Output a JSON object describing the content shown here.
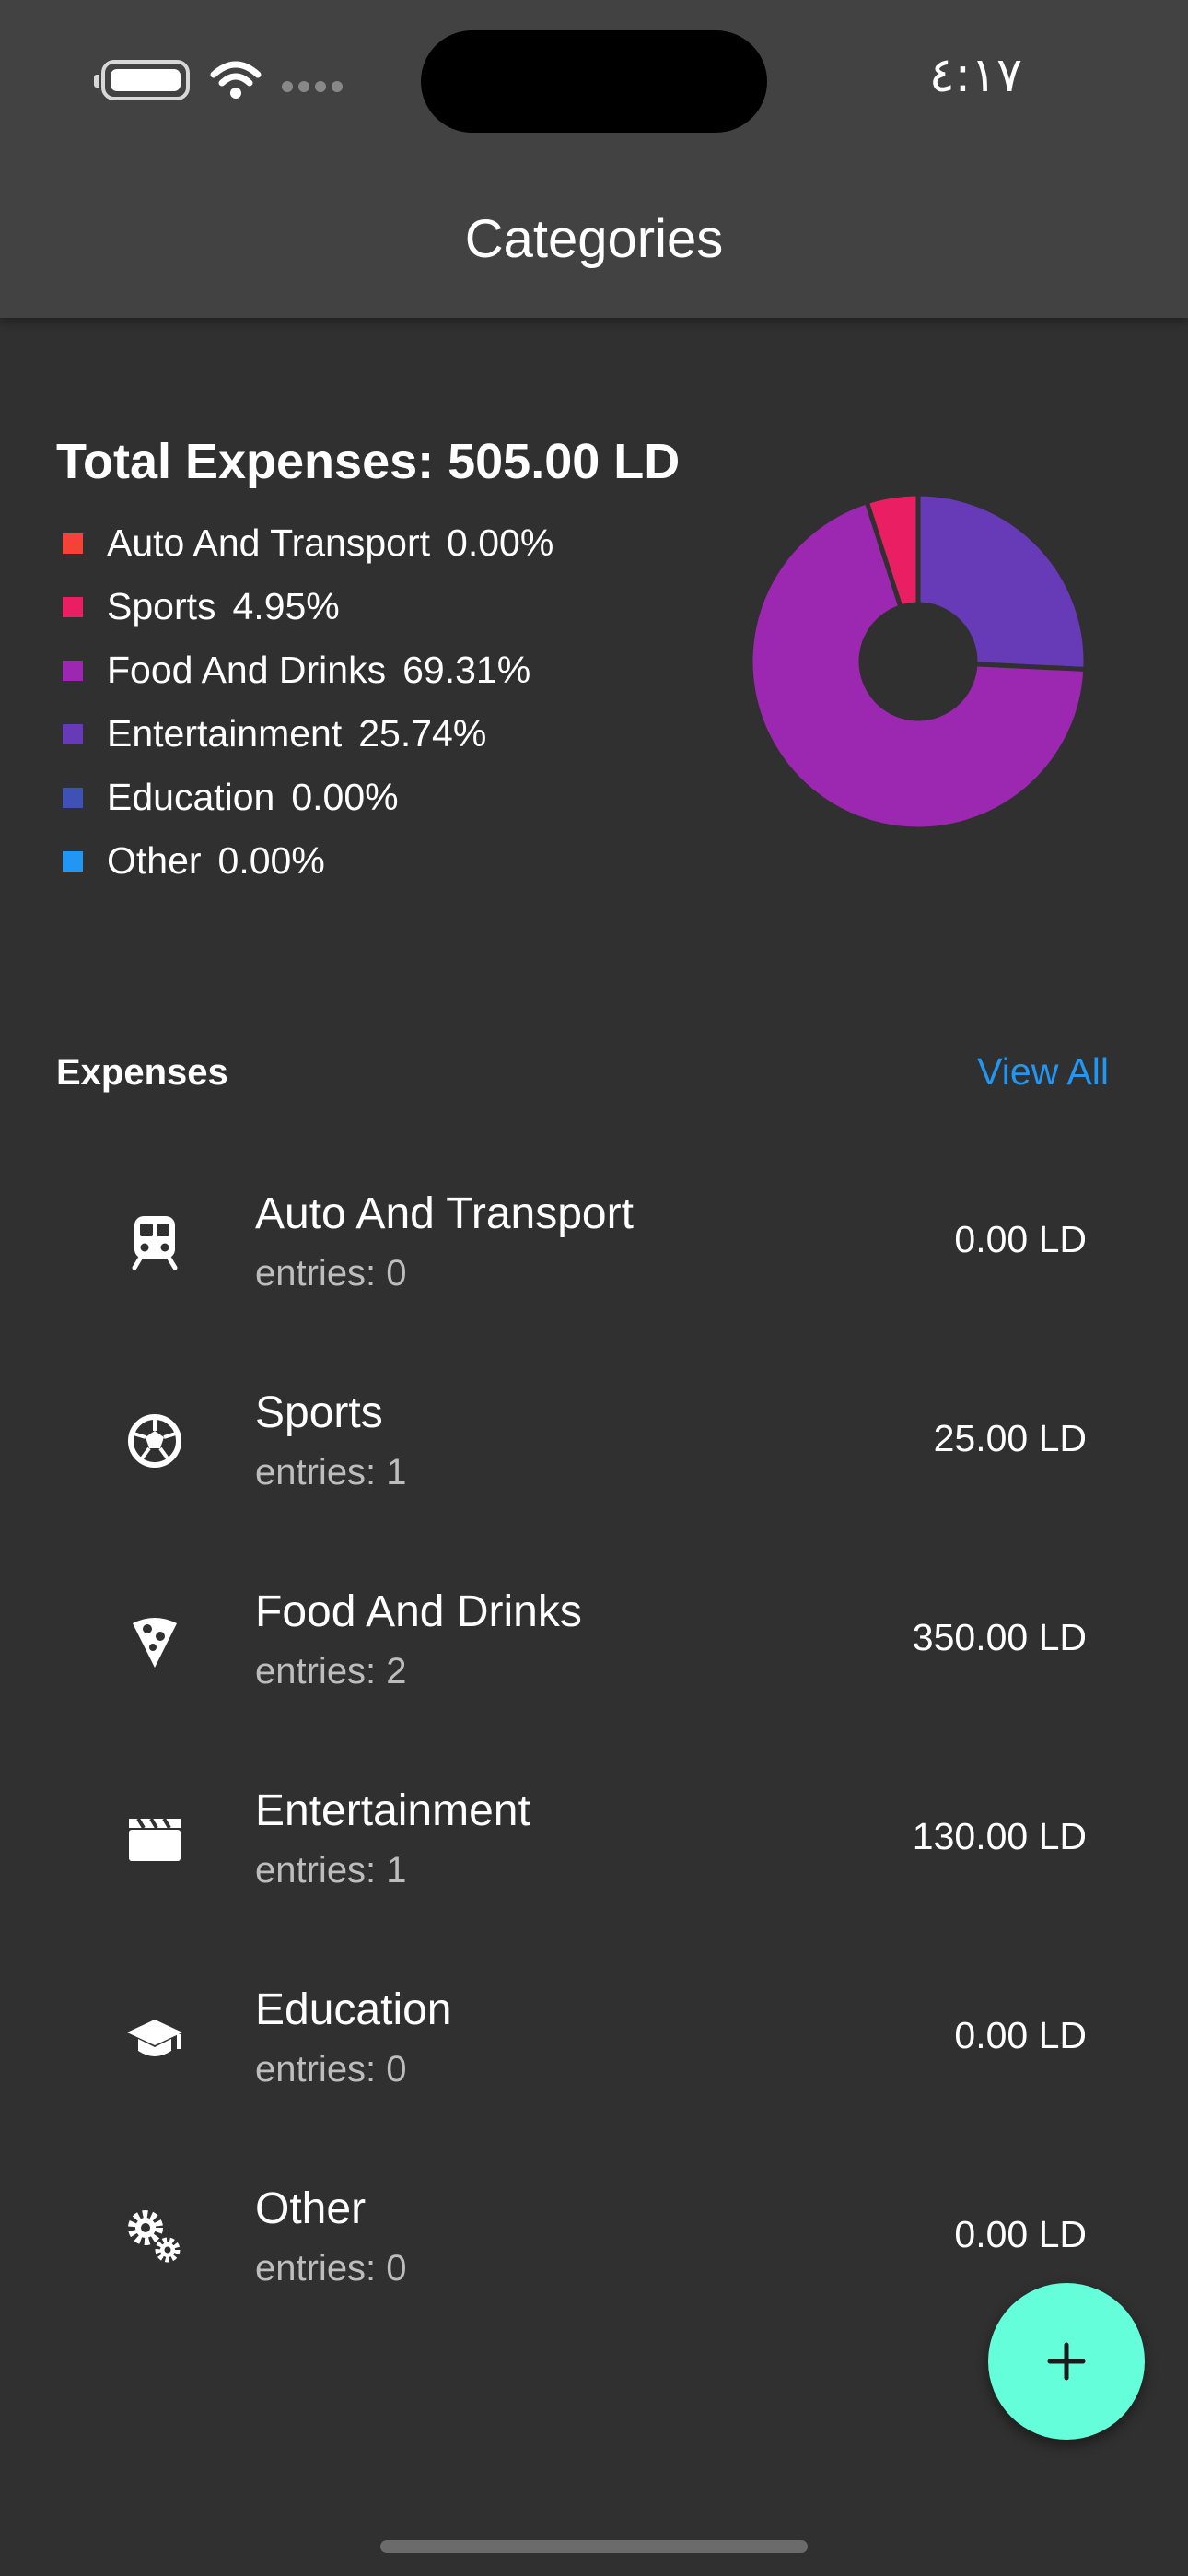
{
  "status_bar": {
    "time": "٤:١٧"
  },
  "appbar": {
    "title": "Categories"
  },
  "summary": {
    "total_label": "Total Expenses: 505.00 LD",
    "legend": [
      {
        "label": "Auto And Transport",
        "percent": "0.00%",
        "color": "#f44336"
      },
      {
        "label": "Sports",
        "percent": "4.95%",
        "color": "#e91e63"
      },
      {
        "label": "Food And Drinks",
        "percent": "69.31%",
        "color": "#9c27b0"
      },
      {
        "label": "Entertainment",
        "percent": "25.74%",
        "color": "#673ab7"
      },
      {
        "label": "Education",
        "percent": "0.00%",
        "color": "#3f51b5"
      },
      {
        "label": "Other",
        "percent": "0.00%",
        "color": "#2196f3"
      }
    ]
  },
  "chart_data": {
    "type": "pie",
    "donut": true,
    "categories": [
      "Auto And Transport",
      "Sports",
      "Food And Drinks",
      "Entertainment",
      "Education",
      "Other"
    ],
    "values": [
      0.0,
      4.95,
      69.31,
      25.74,
      0.0,
      0.0
    ],
    "colors": [
      "#f44336",
      "#e91e63",
      "#9c27b0",
      "#673ab7",
      "#3f51b5",
      "#2196f3"
    ]
  },
  "expenses": {
    "title": "Expenses",
    "view_all": "View All",
    "items": [
      {
        "name": "Auto And Transport",
        "entries": "entries: 0",
        "amount": "0.00 LD",
        "icon": "train-icon"
      },
      {
        "name": "Sports",
        "entries": "entries: 1",
        "amount": "25.00 LD",
        "icon": "soccer-ball-icon"
      },
      {
        "name": "Food And Drinks",
        "entries": "entries: 2",
        "amount": "350.00 LD",
        "icon": "pizza-icon"
      },
      {
        "name": "Entertainment",
        "entries": "entries: 1",
        "amount": "130.00 LD",
        "icon": "clapperboard-icon"
      },
      {
        "name": "Education",
        "entries": "entries: 0",
        "amount": "0.00 LD",
        "icon": "graduation-cap-icon"
      },
      {
        "name": "Other",
        "entries": "entries: 0",
        "amount": "0.00 LD",
        "icon": "gears-icon"
      }
    ]
  },
  "fab": {
    "icon": "plus-icon",
    "color": "#64ffda"
  }
}
